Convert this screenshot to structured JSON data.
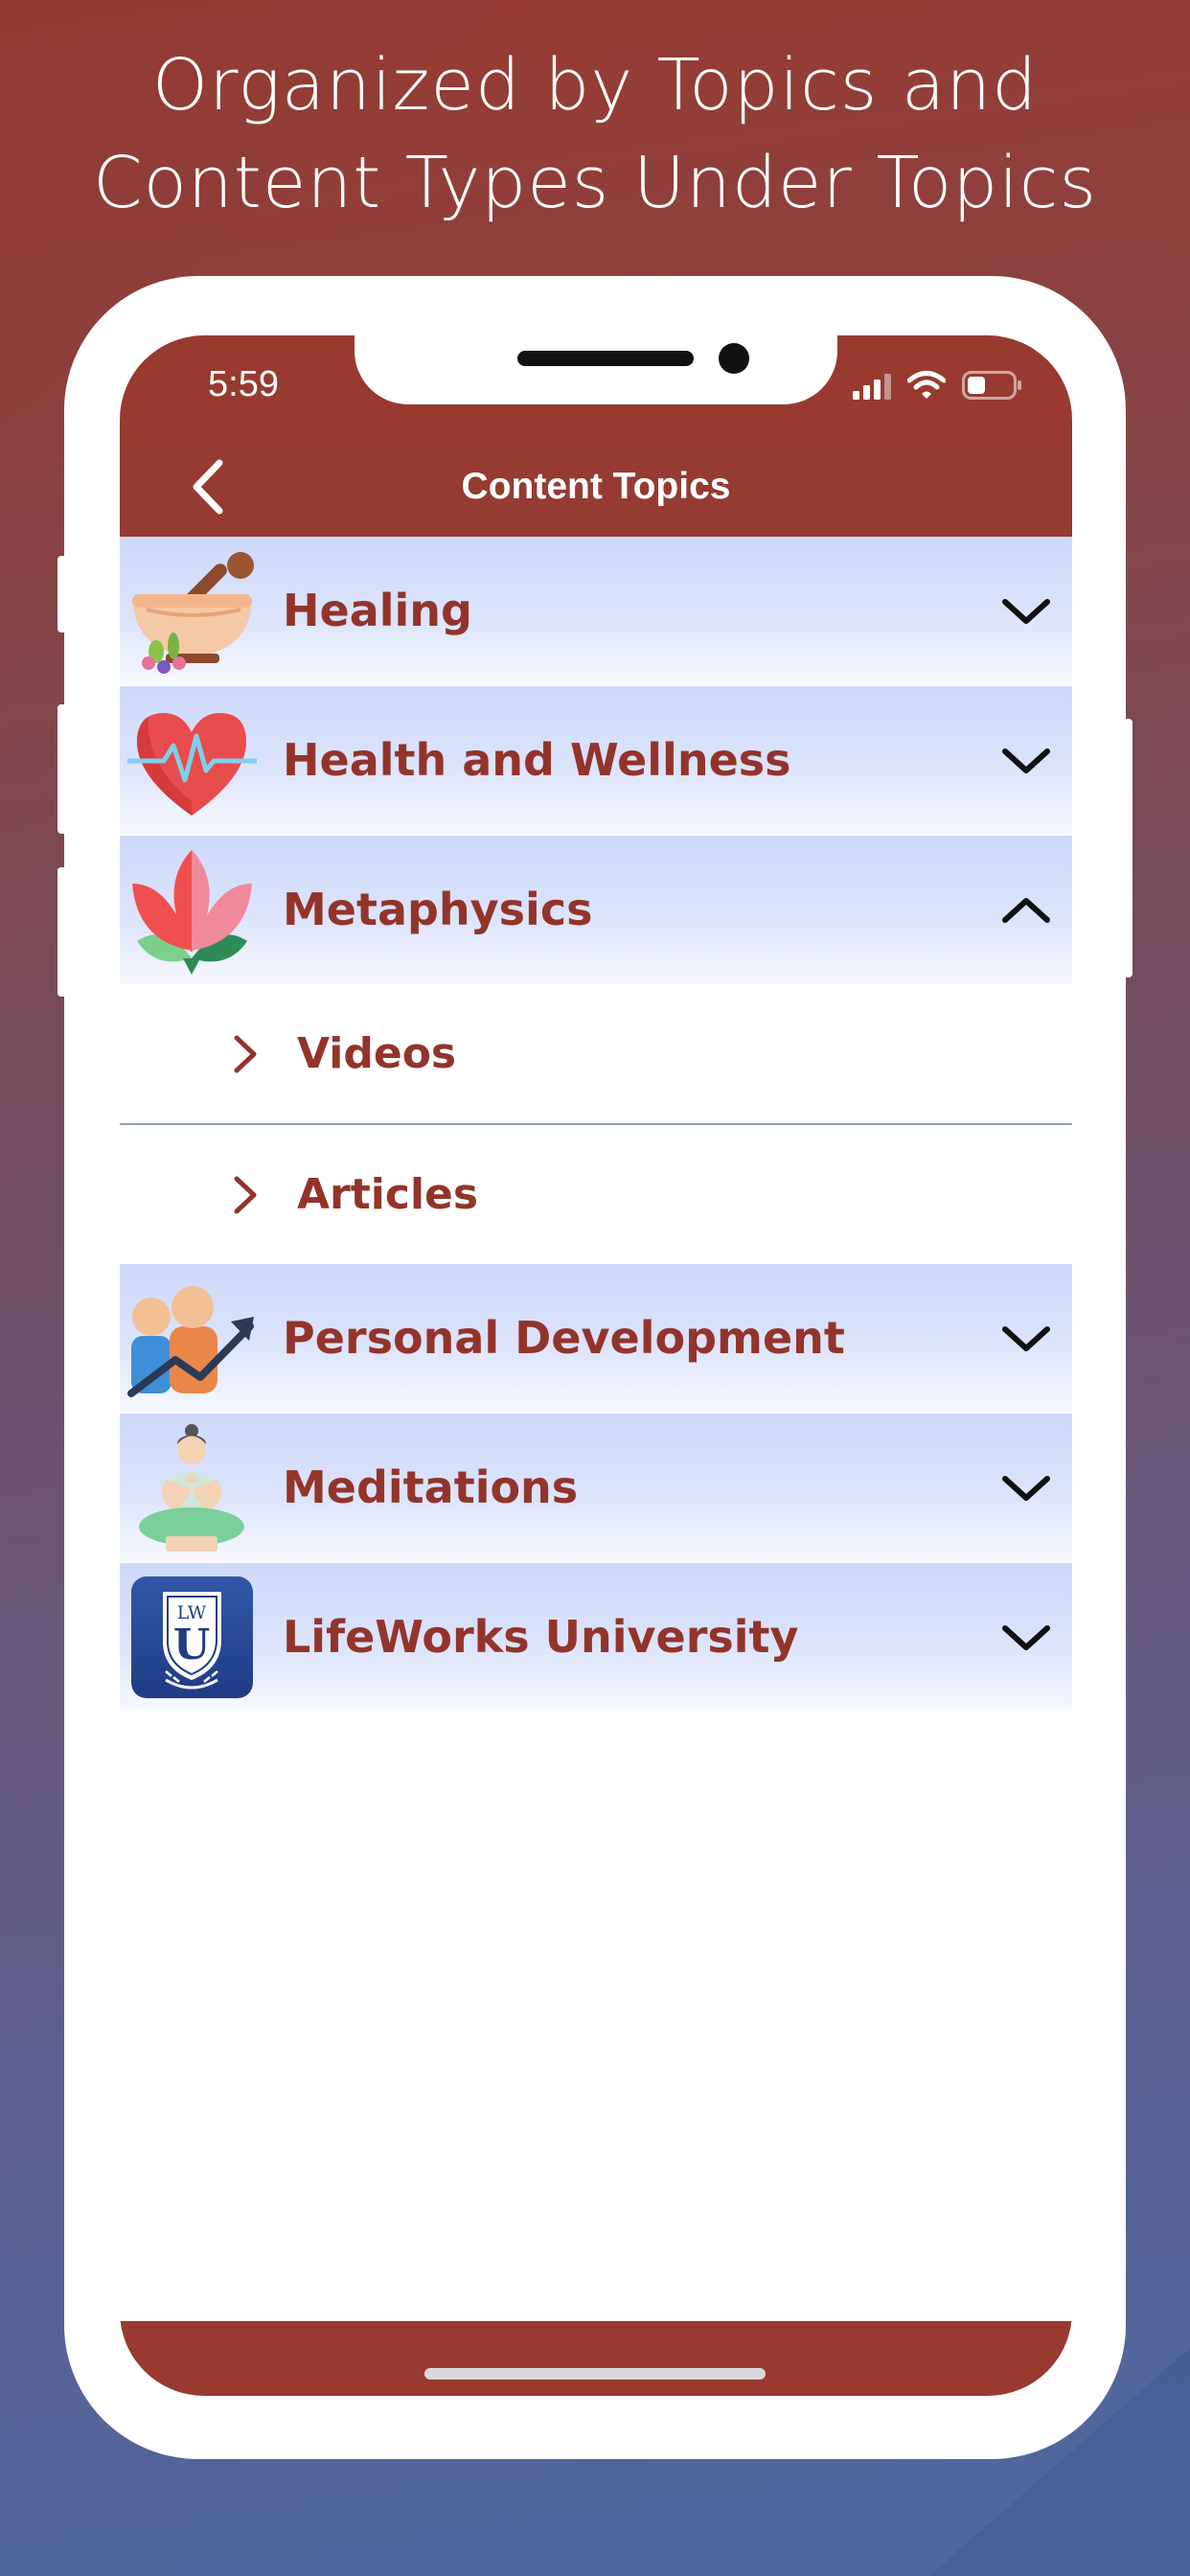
{
  "headline": {
    "line1": "Organized by Topics and",
    "line2": "Content Types Under Topics"
  },
  "status_bar": {
    "time": "5:59",
    "icons": [
      "signal-icon",
      "wifi-icon",
      "battery-icon"
    ]
  },
  "nav": {
    "title": "Content Topics",
    "back_icon": "chevron-left-icon"
  },
  "topics": [
    {
      "label": "Healing",
      "icon": "mortar-pestle-icon",
      "expanded": false
    },
    {
      "label": "Health and Wellness",
      "icon": "heart-pulse-icon",
      "expanded": false
    },
    {
      "label": "Metaphysics",
      "icon": "lotus-icon",
      "expanded": true
    },
    {
      "label": "Personal Development",
      "icon": "people-growth-icon",
      "expanded": false
    },
    {
      "label": "Meditations",
      "icon": "meditation-person-icon",
      "expanded": false
    },
    {
      "label": "LifeWorks University",
      "icon": "lwu-logo-icon",
      "expanded": false
    }
  ],
  "metaphysics_content_types": [
    {
      "label": "Videos"
    },
    {
      "label": "Articles"
    }
  ],
  "logo_lettering": {
    "top": "LW",
    "middle": "U"
  },
  "colors": {
    "brand_red": "#983a30",
    "topic_text": "#93342b",
    "topic_row_gradient": "#ced9fa",
    "background_bottom": "#4e68a2"
  }
}
